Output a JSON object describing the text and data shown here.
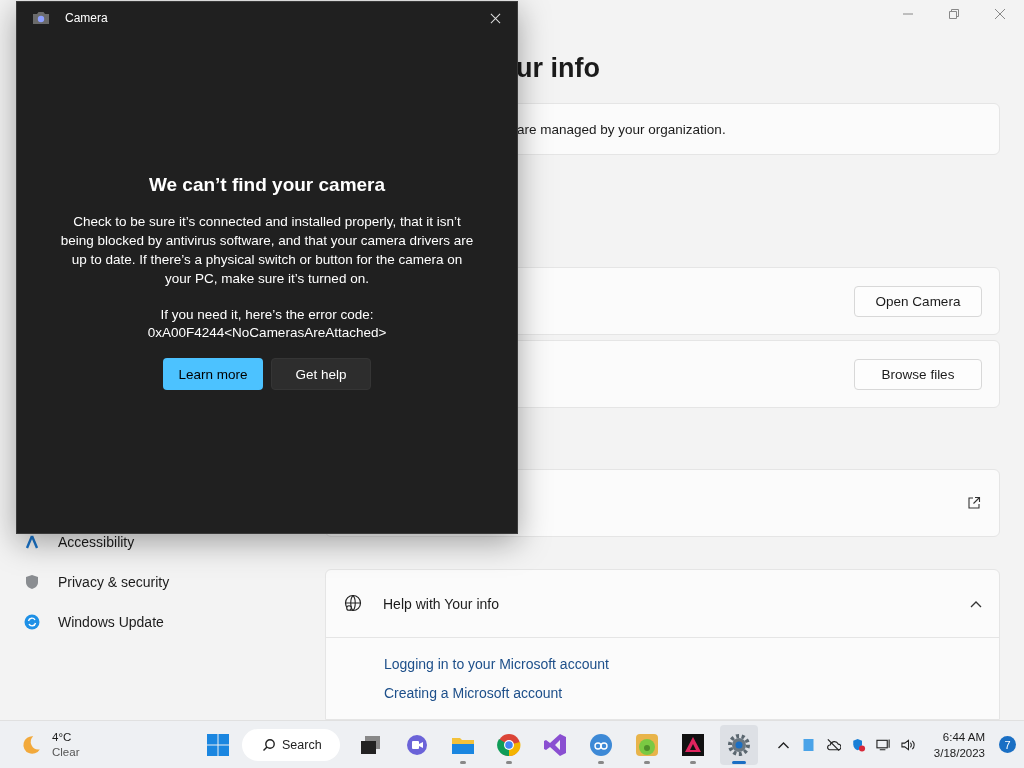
{
  "settings": {
    "heading": "ur info",
    "notice": "are managed by your organization.",
    "sidebar": [
      {
        "label": "Accessibility"
      },
      {
        "label": "Privacy & security"
      },
      {
        "label": "Windows Update"
      }
    ],
    "cards": [
      {
        "kind": "button",
        "button": "Open Camera"
      },
      {
        "kind": "button",
        "button": "Browse files"
      },
      {
        "kind": "link"
      }
    ],
    "help": {
      "title": "Help with Your info",
      "expanded": true,
      "links": [
        "Logging in to your Microsoft account",
        "Creating a Microsoft account"
      ]
    }
  },
  "dialog": {
    "title": "Camera",
    "heading": "We can’t find your camera",
    "message": "Check to be sure it’s connected and installed properly, that it isn’t being blocked by antivirus software, and that your camera drivers are up to date. If there’s a physical switch or button for the camera on your PC, make sure it’s turned on.",
    "error_label": "If you need it, here’s the error code:",
    "error_code": "0xA00F4244<NoCamerasAreAttached>",
    "buttons": [
      {
        "label": "Learn more",
        "kind": "primary"
      },
      {
        "label": "Get help",
        "kind": "secondary"
      }
    ]
  },
  "taskbar": {
    "weather": {
      "temp": "4°C",
      "condition": "Clear"
    },
    "search": "Search",
    "apps": [
      {
        "kind": "taskview",
        "running": false,
        "selected": false
      },
      {
        "kind": "chat",
        "running": false,
        "selected": false
      },
      {
        "kind": "folder",
        "running": true,
        "selected": false
      },
      {
        "kind": "browser",
        "running": true,
        "selected": false
      },
      {
        "kind": "studio",
        "running": false,
        "selected": false
      },
      {
        "kind": "qb",
        "running": true,
        "selected": false
      },
      {
        "kind": "game",
        "running": true,
        "selected": false
      },
      {
        "kind": "triangle",
        "running": true,
        "selected": false
      },
      {
        "kind": "gear",
        "running": true,
        "selected": true
      }
    ],
    "time": "6:44 AM",
    "date": "3/18/2023",
    "notifications": "7"
  }
}
